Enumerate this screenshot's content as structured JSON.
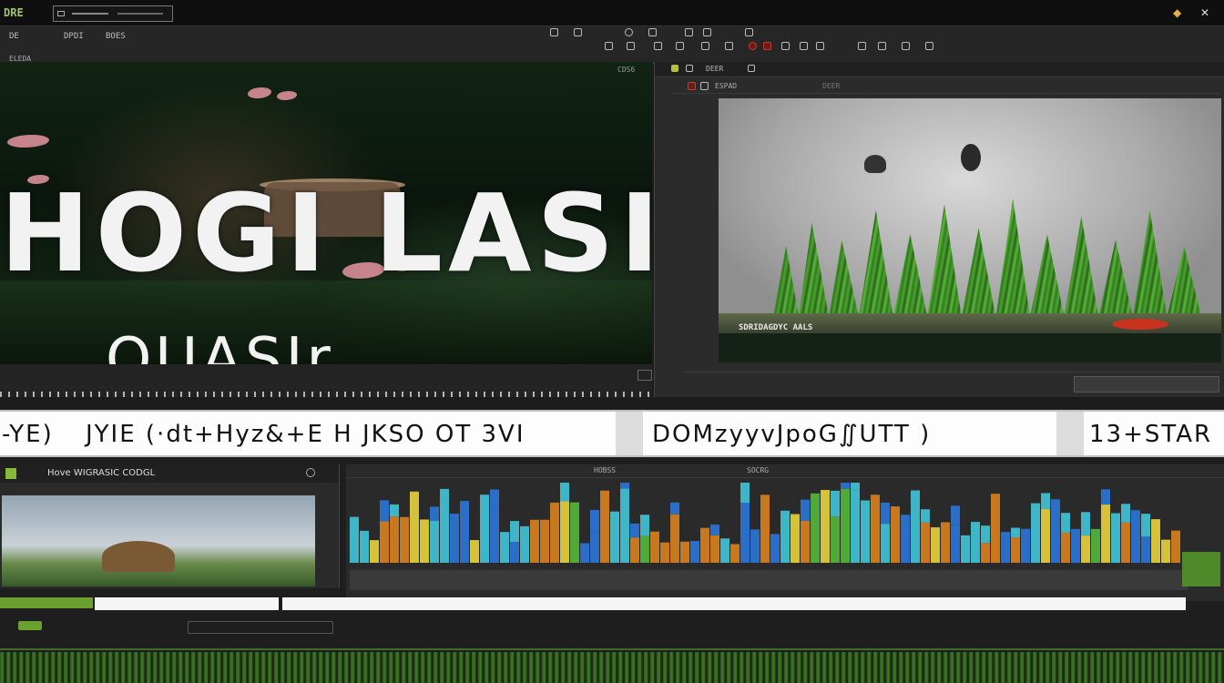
{
  "app": {
    "logo": "DRE"
  },
  "menubar": {
    "items": [
      "DE",
      "DPDI",
      "BOES"
    ],
    "sub_label": "ELEDA"
  },
  "viewer_left": {
    "corner_label": "CDS6",
    "overlay_title": "HOGI LASIO",
    "overlay_subtitle": "QUASIr"
  },
  "viewer_right": {
    "tab_label": "DEER",
    "sub_label": "ESPAD",
    "caption": "SDRIDAGDYC AALS"
  },
  "text_strip": {
    "segments": [
      "-YE)",
      "JYIE (·dt+Hyz&+E H JKSO OT 3VI",
      "DOMzyyvJpoG∬UTT )",
      "13+STAR"
    ]
  },
  "clip_panel": {
    "title": "Hove WIGRASIC CODGL"
  },
  "timeline": {
    "marker_labels": [
      "HOBSS",
      "SOCRG"
    ]
  },
  "colors": {
    "accent_green": "#8ab83c",
    "bar_orange": "#c8791f",
    "bar_blue": "#2a6ec8",
    "bar_cyan": "#3fb5c8",
    "bar_green": "#4faa3a",
    "bar_yellow": "#d6c23a",
    "warning_yellow": "#e0b040"
  },
  "icons": {
    "bell": "bell-icon",
    "close": "close-icon",
    "record": "record-icon"
  }
}
